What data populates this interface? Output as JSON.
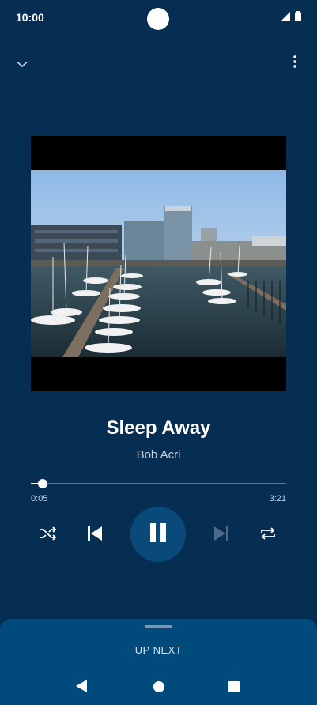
{
  "status_bar": {
    "time": "10:00",
    "icons": [
      "signal-icon",
      "battery-icon"
    ]
  },
  "top_bar": {
    "icons": [
      "chevron-down-icon",
      "more-vert-icon"
    ]
  },
  "now_playing": {
    "title": "Sleep Away",
    "artist": "Bob Acri",
    "elapsed": "0:05",
    "duration": "3:21",
    "progress_fraction": 0.025
  },
  "controls": {
    "icons": [
      "shuffle-icon",
      "skip-previous-icon",
      "pause-icon",
      "skip-next-icon",
      "repeat-icon"
    ],
    "next_enabled": false
  },
  "up_next": {
    "label": "UP NEXT"
  },
  "navigation": {
    "icons": [
      "back-icon",
      "home-icon",
      "recents-icon"
    ]
  },
  "colors": {
    "background": "#062d52",
    "sheet": "#004a7c",
    "play_button": "#0a4a7a",
    "secondary_text": "#c6d4e3"
  }
}
